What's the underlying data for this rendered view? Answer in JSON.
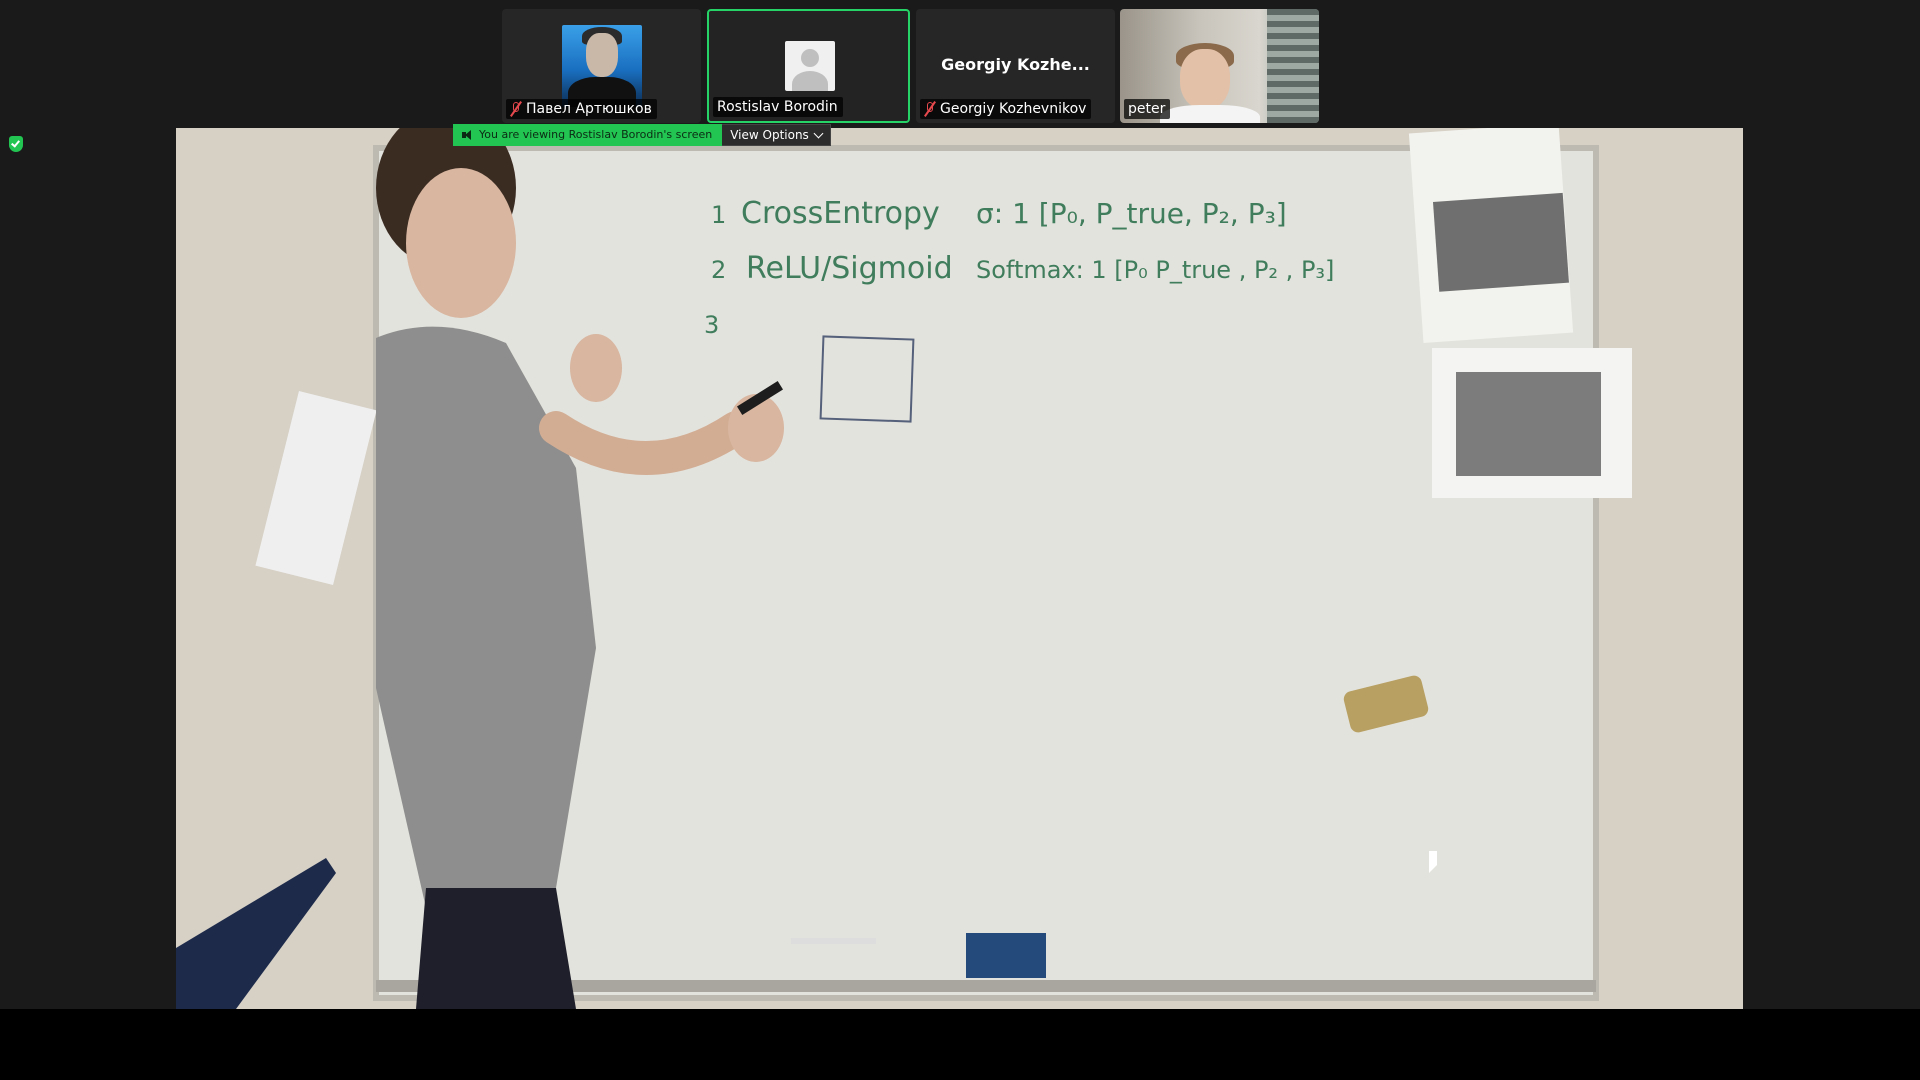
{
  "participants": [
    {
      "name": "Павел Артюшков",
      "muted": true,
      "type": "avatar"
    },
    {
      "name": "Rostislav Borodin",
      "muted": false,
      "active": true,
      "type": "placeholder"
    },
    {
      "name": "Georgiy Kozhevnikov",
      "display_title": "Georgiy Kozhe...",
      "muted": true,
      "type": "name"
    },
    {
      "name": "peter",
      "muted": false,
      "type": "camera"
    }
  ],
  "banner": {
    "viewing_text": "You are viewing Rostislav Borodin's screen",
    "view_options_label": "View Options"
  },
  "whiteboard": {
    "lines": [
      {
        "number": "1",
        "text": "CrossEntropy",
        "extra": "σ:   1   [P₀, P_true, P₂, P₃]"
      },
      {
        "number": "2",
        "text": "ReLU/Sigmoid",
        "extra": "Softmax:   1   [P₀  P_true , P₂ , P₃]"
      },
      {
        "number": "3",
        "text": "",
        "extra": ""
      }
    ]
  },
  "colors": {
    "accent_green": "#23c552",
    "active_border": "#25d366",
    "muted_red": "#e5484d",
    "marker_green": "#3f7d5c"
  }
}
